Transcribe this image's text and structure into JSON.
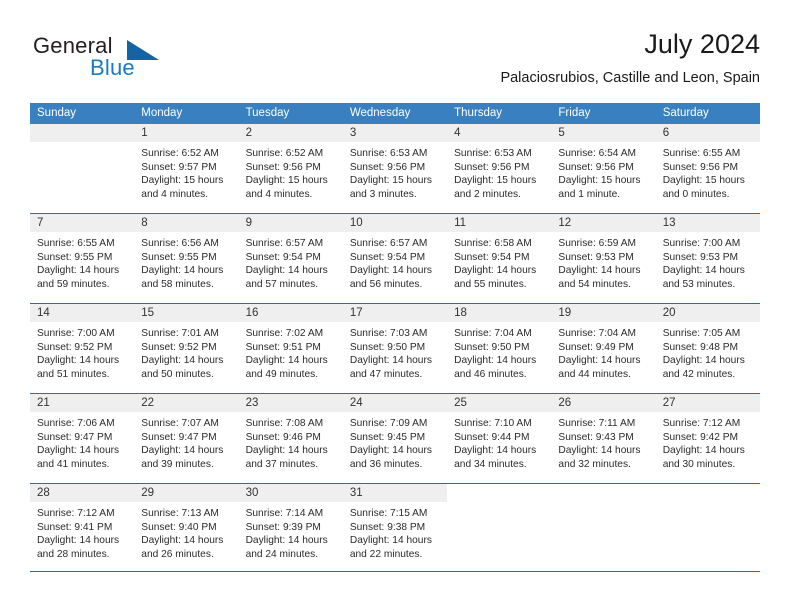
{
  "brand": {
    "text_general": "General",
    "text_blue": "Blue",
    "logo_icon": "triangle-icon"
  },
  "header": {
    "title": "July 2024",
    "subtitle": "Palaciosrubios, Castille and Leon, Spain"
  },
  "colors": {
    "header_blue": "#3880c0",
    "rule_blue": "#2e6da4",
    "day_band_gray": "#efefef",
    "brand_blue": "#1a7ac4"
  },
  "weekdays": [
    "Sunday",
    "Monday",
    "Tuesday",
    "Wednesday",
    "Thursday",
    "Friday",
    "Saturday"
  ],
  "weeks": [
    [
      {
        "day": "",
        "sunrise": "",
        "sunset": "",
        "daylight1": "",
        "daylight2": "",
        "empty": true
      },
      {
        "day": "1",
        "sunrise": "Sunrise: 6:52 AM",
        "sunset": "Sunset: 9:57 PM",
        "daylight1": "Daylight: 15 hours",
        "daylight2": "and 4 minutes."
      },
      {
        "day": "2",
        "sunrise": "Sunrise: 6:52 AM",
        "sunset": "Sunset: 9:56 PM",
        "daylight1": "Daylight: 15 hours",
        "daylight2": "and 4 minutes."
      },
      {
        "day": "3",
        "sunrise": "Sunrise: 6:53 AM",
        "sunset": "Sunset: 9:56 PM",
        "daylight1": "Daylight: 15 hours",
        "daylight2": "and 3 minutes."
      },
      {
        "day": "4",
        "sunrise": "Sunrise: 6:53 AM",
        "sunset": "Sunset: 9:56 PM",
        "daylight1": "Daylight: 15 hours",
        "daylight2": "and 2 minutes."
      },
      {
        "day": "5",
        "sunrise": "Sunrise: 6:54 AM",
        "sunset": "Sunset: 9:56 PM",
        "daylight1": "Daylight: 15 hours",
        "daylight2": "and 1 minute."
      },
      {
        "day": "6",
        "sunrise": "Sunrise: 6:55 AM",
        "sunset": "Sunset: 9:56 PM",
        "daylight1": "Daylight: 15 hours",
        "daylight2": "and 0 minutes."
      }
    ],
    [
      {
        "day": "7",
        "sunrise": "Sunrise: 6:55 AM",
        "sunset": "Sunset: 9:55 PM",
        "daylight1": "Daylight: 14 hours",
        "daylight2": "and 59 minutes."
      },
      {
        "day": "8",
        "sunrise": "Sunrise: 6:56 AM",
        "sunset": "Sunset: 9:55 PM",
        "daylight1": "Daylight: 14 hours",
        "daylight2": "and 58 minutes."
      },
      {
        "day": "9",
        "sunrise": "Sunrise: 6:57 AM",
        "sunset": "Sunset: 9:54 PM",
        "daylight1": "Daylight: 14 hours",
        "daylight2": "and 57 minutes."
      },
      {
        "day": "10",
        "sunrise": "Sunrise: 6:57 AM",
        "sunset": "Sunset: 9:54 PM",
        "daylight1": "Daylight: 14 hours",
        "daylight2": "and 56 minutes."
      },
      {
        "day": "11",
        "sunrise": "Sunrise: 6:58 AM",
        "sunset": "Sunset: 9:54 PM",
        "daylight1": "Daylight: 14 hours",
        "daylight2": "and 55 minutes."
      },
      {
        "day": "12",
        "sunrise": "Sunrise: 6:59 AM",
        "sunset": "Sunset: 9:53 PM",
        "daylight1": "Daylight: 14 hours",
        "daylight2": "and 54 minutes."
      },
      {
        "day": "13",
        "sunrise": "Sunrise: 7:00 AM",
        "sunset": "Sunset: 9:53 PM",
        "daylight1": "Daylight: 14 hours",
        "daylight2": "and 53 minutes."
      }
    ],
    [
      {
        "day": "14",
        "sunrise": "Sunrise: 7:00 AM",
        "sunset": "Sunset: 9:52 PM",
        "daylight1": "Daylight: 14 hours",
        "daylight2": "and 51 minutes."
      },
      {
        "day": "15",
        "sunrise": "Sunrise: 7:01 AM",
        "sunset": "Sunset: 9:52 PM",
        "daylight1": "Daylight: 14 hours",
        "daylight2": "and 50 minutes."
      },
      {
        "day": "16",
        "sunrise": "Sunrise: 7:02 AM",
        "sunset": "Sunset: 9:51 PM",
        "daylight1": "Daylight: 14 hours",
        "daylight2": "and 49 minutes."
      },
      {
        "day": "17",
        "sunrise": "Sunrise: 7:03 AM",
        "sunset": "Sunset: 9:50 PM",
        "daylight1": "Daylight: 14 hours",
        "daylight2": "and 47 minutes."
      },
      {
        "day": "18",
        "sunrise": "Sunrise: 7:04 AM",
        "sunset": "Sunset: 9:50 PM",
        "daylight1": "Daylight: 14 hours",
        "daylight2": "and 46 minutes."
      },
      {
        "day": "19",
        "sunrise": "Sunrise: 7:04 AM",
        "sunset": "Sunset: 9:49 PM",
        "daylight1": "Daylight: 14 hours",
        "daylight2": "and 44 minutes."
      },
      {
        "day": "20",
        "sunrise": "Sunrise: 7:05 AM",
        "sunset": "Sunset: 9:48 PM",
        "daylight1": "Daylight: 14 hours",
        "daylight2": "and 42 minutes."
      }
    ],
    [
      {
        "day": "21",
        "sunrise": "Sunrise: 7:06 AM",
        "sunset": "Sunset: 9:47 PM",
        "daylight1": "Daylight: 14 hours",
        "daylight2": "and 41 minutes."
      },
      {
        "day": "22",
        "sunrise": "Sunrise: 7:07 AM",
        "sunset": "Sunset: 9:47 PM",
        "daylight1": "Daylight: 14 hours",
        "daylight2": "and 39 minutes."
      },
      {
        "day": "23",
        "sunrise": "Sunrise: 7:08 AM",
        "sunset": "Sunset: 9:46 PM",
        "daylight1": "Daylight: 14 hours",
        "daylight2": "and 37 minutes."
      },
      {
        "day": "24",
        "sunrise": "Sunrise: 7:09 AM",
        "sunset": "Sunset: 9:45 PM",
        "daylight1": "Daylight: 14 hours",
        "daylight2": "and 36 minutes."
      },
      {
        "day": "25",
        "sunrise": "Sunrise: 7:10 AM",
        "sunset": "Sunset: 9:44 PM",
        "daylight1": "Daylight: 14 hours",
        "daylight2": "and 34 minutes."
      },
      {
        "day": "26",
        "sunrise": "Sunrise: 7:11 AM",
        "sunset": "Sunset: 9:43 PM",
        "daylight1": "Daylight: 14 hours",
        "daylight2": "and 32 minutes."
      },
      {
        "day": "27",
        "sunrise": "Sunrise: 7:12 AM",
        "sunset": "Sunset: 9:42 PM",
        "daylight1": "Daylight: 14 hours",
        "daylight2": "and 30 minutes."
      }
    ],
    [
      {
        "day": "28",
        "sunrise": "Sunrise: 7:12 AM",
        "sunset": "Sunset: 9:41 PM",
        "daylight1": "Daylight: 14 hours",
        "daylight2": "and 28 minutes."
      },
      {
        "day": "29",
        "sunrise": "Sunrise: 7:13 AM",
        "sunset": "Sunset: 9:40 PM",
        "daylight1": "Daylight: 14 hours",
        "daylight2": "and 26 minutes."
      },
      {
        "day": "30",
        "sunrise": "Sunrise: 7:14 AM",
        "sunset": "Sunset: 9:39 PM",
        "daylight1": "Daylight: 14 hours",
        "daylight2": "and 24 minutes."
      },
      {
        "day": "31",
        "sunrise": "Sunrise: 7:15 AM",
        "sunset": "Sunset: 9:38 PM",
        "daylight1": "Daylight: 14 hours",
        "daylight2": "and 22 minutes."
      },
      {
        "day": "",
        "sunrise": "",
        "sunset": "",
        "daylight1": "",
        "daylight2": "",
        "empty": true,
        "noband": true
      },
      {
        "day": "",
        "sunrise": "",
        "sunset": "",
        "daylight1": "",
        "daylight2": "",
        "empty": true,
        "noband": true
      },
      {
        "day": "",
        "sunrise": "",
        "sunset": "",
        "daylight1": "",
        "daylight2": "",
        "empty": true,
        "noband": true
      }
    ]
  ]
}
